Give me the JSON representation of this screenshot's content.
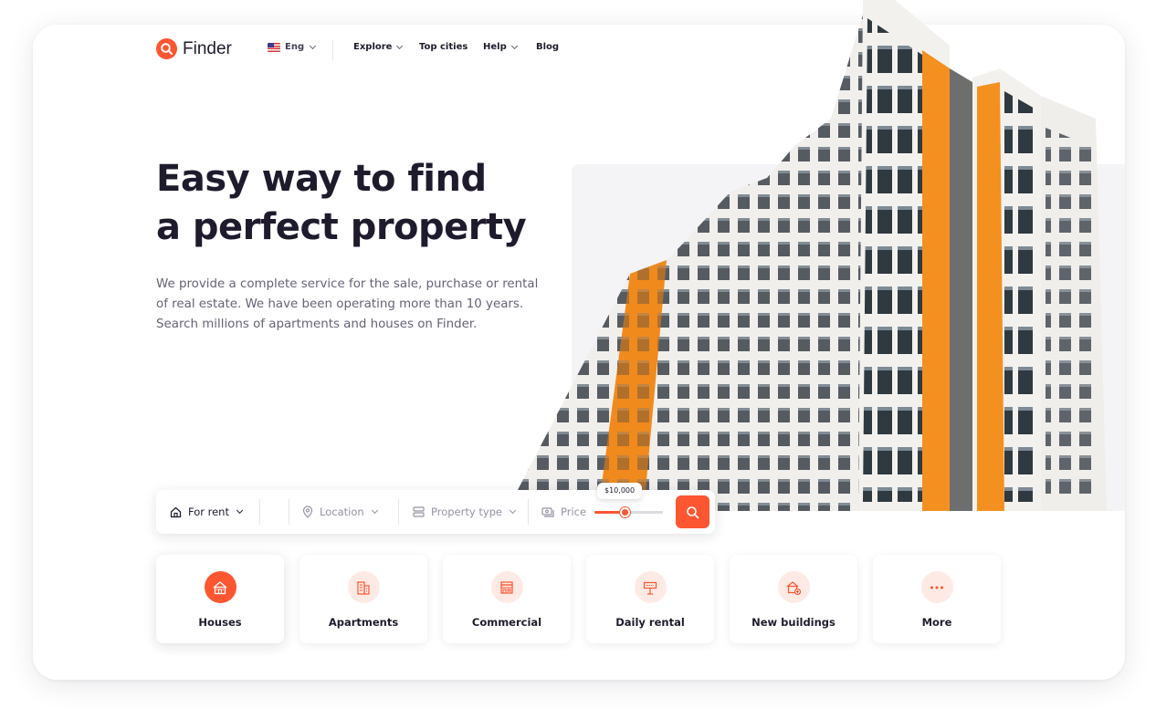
{
  "header": {
    "logo_text": "Finder",
    "language": "Eng",
    "nav": [
      {
        "label": "Explore",
        "has_dropdown": true
      },
      {
        "label": "Top cities",
        "has_dropdown": false
      },
      {
        "label": "Help",
        "has_dropdown": true
      },
      {
        "label": "Blog",
        "has_dropdown": false
      }
    ]
  },
  "hero": {
    "title_line1": "Easy way to find",
    "title_line2": "a perfect property",
    "description_line1": "We provide a complete service for the sale, purchase or rental",
    "description_line2": "of real estate. We have been operating more than 10 years.",
    "description_line3": "Search millions of apartments and houses on Finder."
  },
  "search": {
    "mode": "For rent",
    "location_placeholder": "Location",
    "property_type_placeholder": "Property type",
    "price_label": "Price",
    "price_value": "$10,000",
    "price_slider_fraction": 0.45
  },
  "categories": [
    {
      "label": "Houses",
      "icon": "house-icon",
      "active": true
    },
    {
      "label": "Apartments",
      "icon": "apartment-icon",
      "active": false
    },
    {
      "label": "Commercial",
      "icon": "shop-icon",
      "active": false
    },
    {
      "label": "Daily rental",
      "icon": "rent-sign-icon",
      "active": false
    },
    {
      "label": "New buildings",
      "icon": "new-building-icon",
      "active": false
    },
    {
      "label": "More",
      "icon": "dots-icon",
      "active": false
    }
  ],
  "colors": {
    "accent": "#fd5631",
    "accent_light": "#feeae5",
    "heading": "#1f1b2d",
    "body_text": "#666276"
  }
}
